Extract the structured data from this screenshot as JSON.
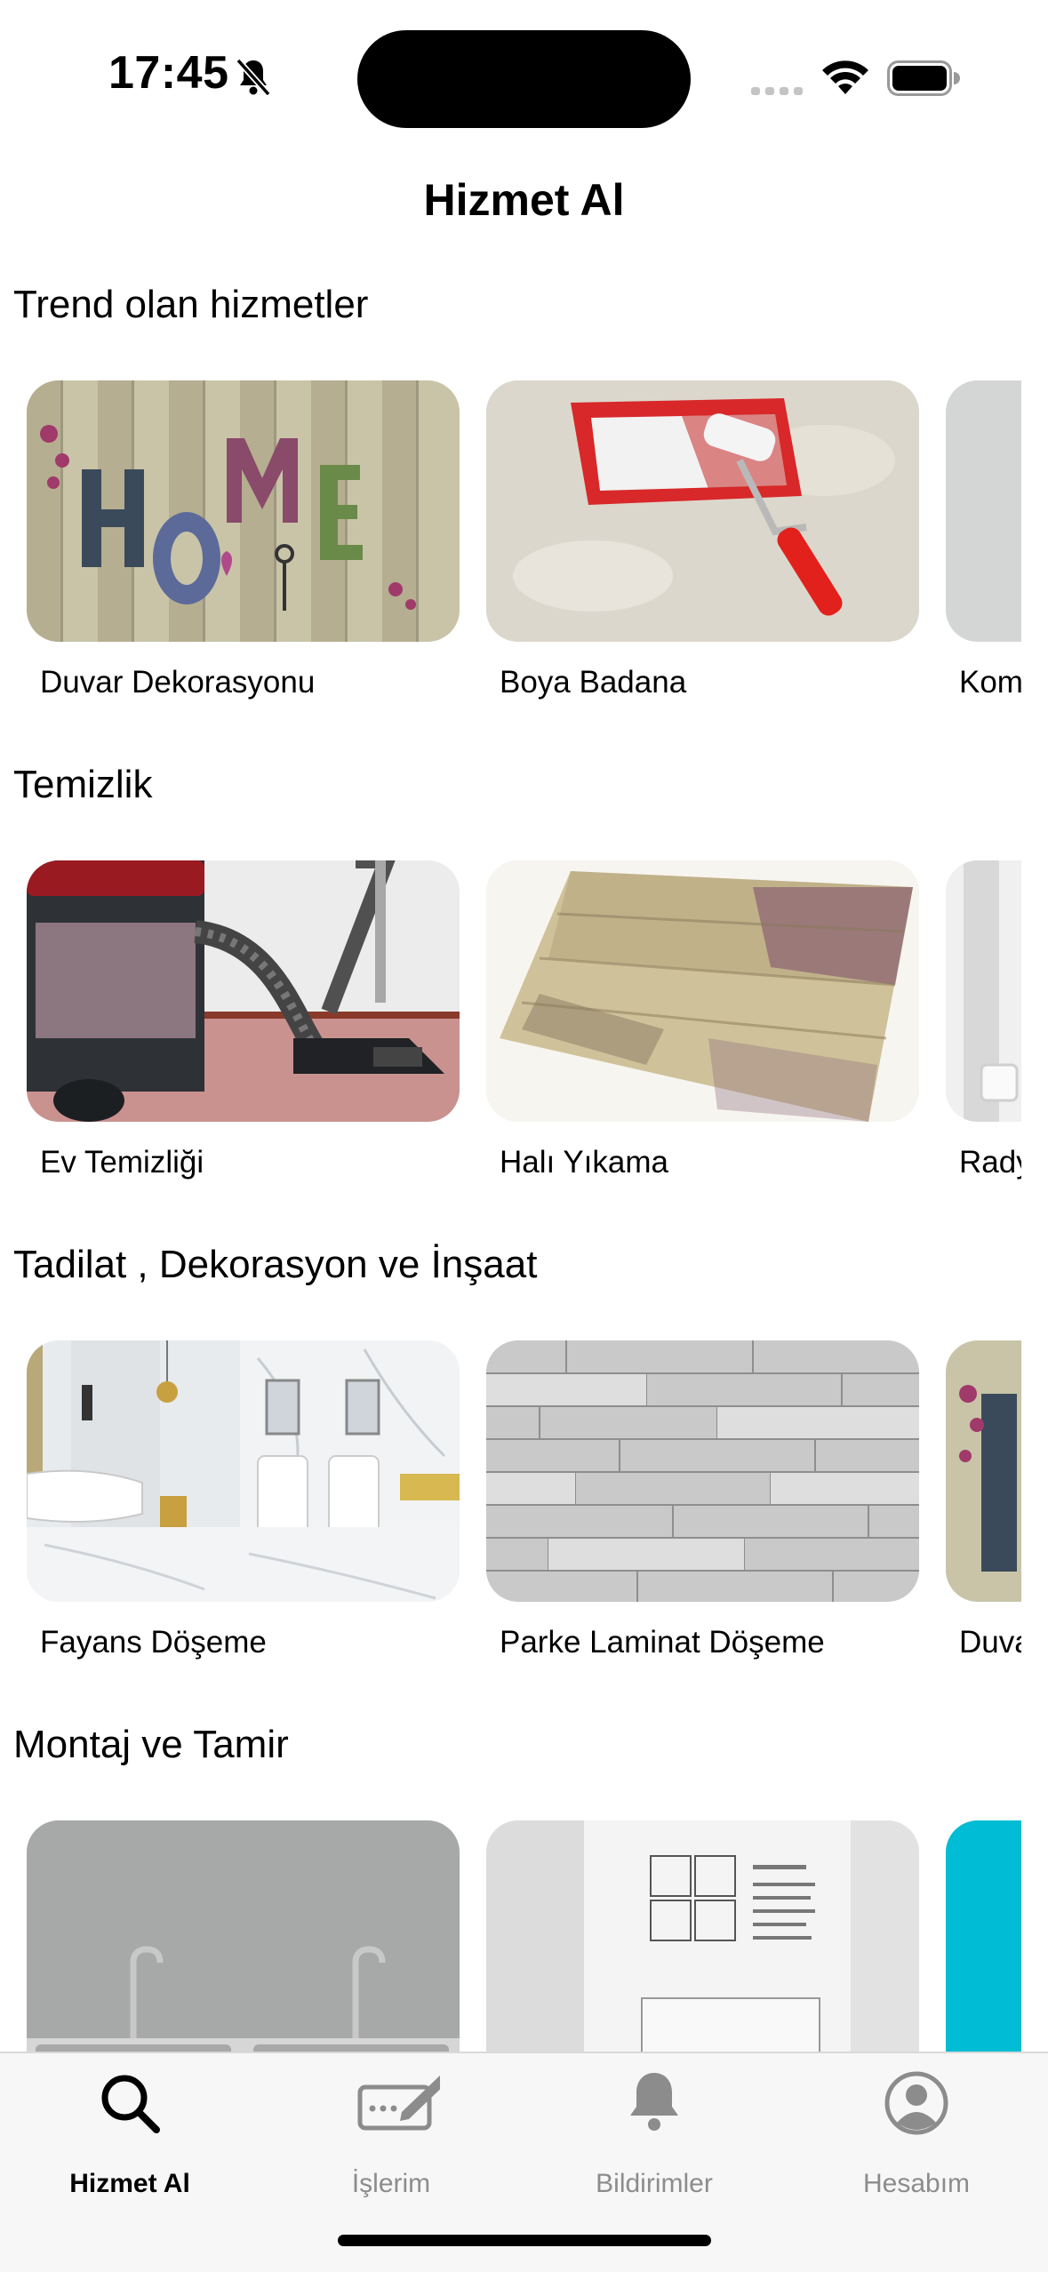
{
  "status_bar": {
    "time": "17:45"
  },
  "header": {
    "title": "Hizmet Al"
  },
  "sections": [
    {
      "title": "Trend olan hizmetler",
      "cards": [
        {
          "label": "Duvar Dekorasyonu"
        },
        {
          "label": "Boya Badana"
        },
        {
          "label": "Kom"
        }
      ]
    },
    {
      "title": "Temizlik",
      "cards": [
        {
          "label": "Ev Temizliği"
        },
        {
          "label": "Halı Yıkama"
        },
        {
          "label": "Rady"
        }
      ]
    },
    {
      "title": "Tadilat , Dekorasyon ve İnşaat",
      "cards": [
        {
          "label": "Fayans Döşeme"
        },
        {
          "label": "Parke Laminat Döşeme"
        },
        {
          "label": "Duva"
        }
      ]
    },
    {
      "title": "Montaj ve Tamir",
      "cards": [
        {
          "label": ""
        },
        {
          "label": ""
        },
        {
          "label": ""
        }
      ]
    }
  ],
  "tabbar": {
    "tabs": [
      {
        "label": "Hizmet Al",
        "icon": "search-icon",
        "active": true
      },
      {
        "label": "İşlerim",
        "icon": "pencil-icon",
        "active": false
      },
      {
        "label": "Bildirimler",
        "icon": "bell-icon",
        "active": false
      },
      {
        "label": "Hesabım",
        "icon": "profile-icon",
        "active": false
      }
    ]
  },
  "colors": {
    "active": "#000000",
    "inactive": "#8c8c8c",
    "tabbar_bg": "#f7f7f7",
    "accent_cyan": "#00bcd4"
  }
}
